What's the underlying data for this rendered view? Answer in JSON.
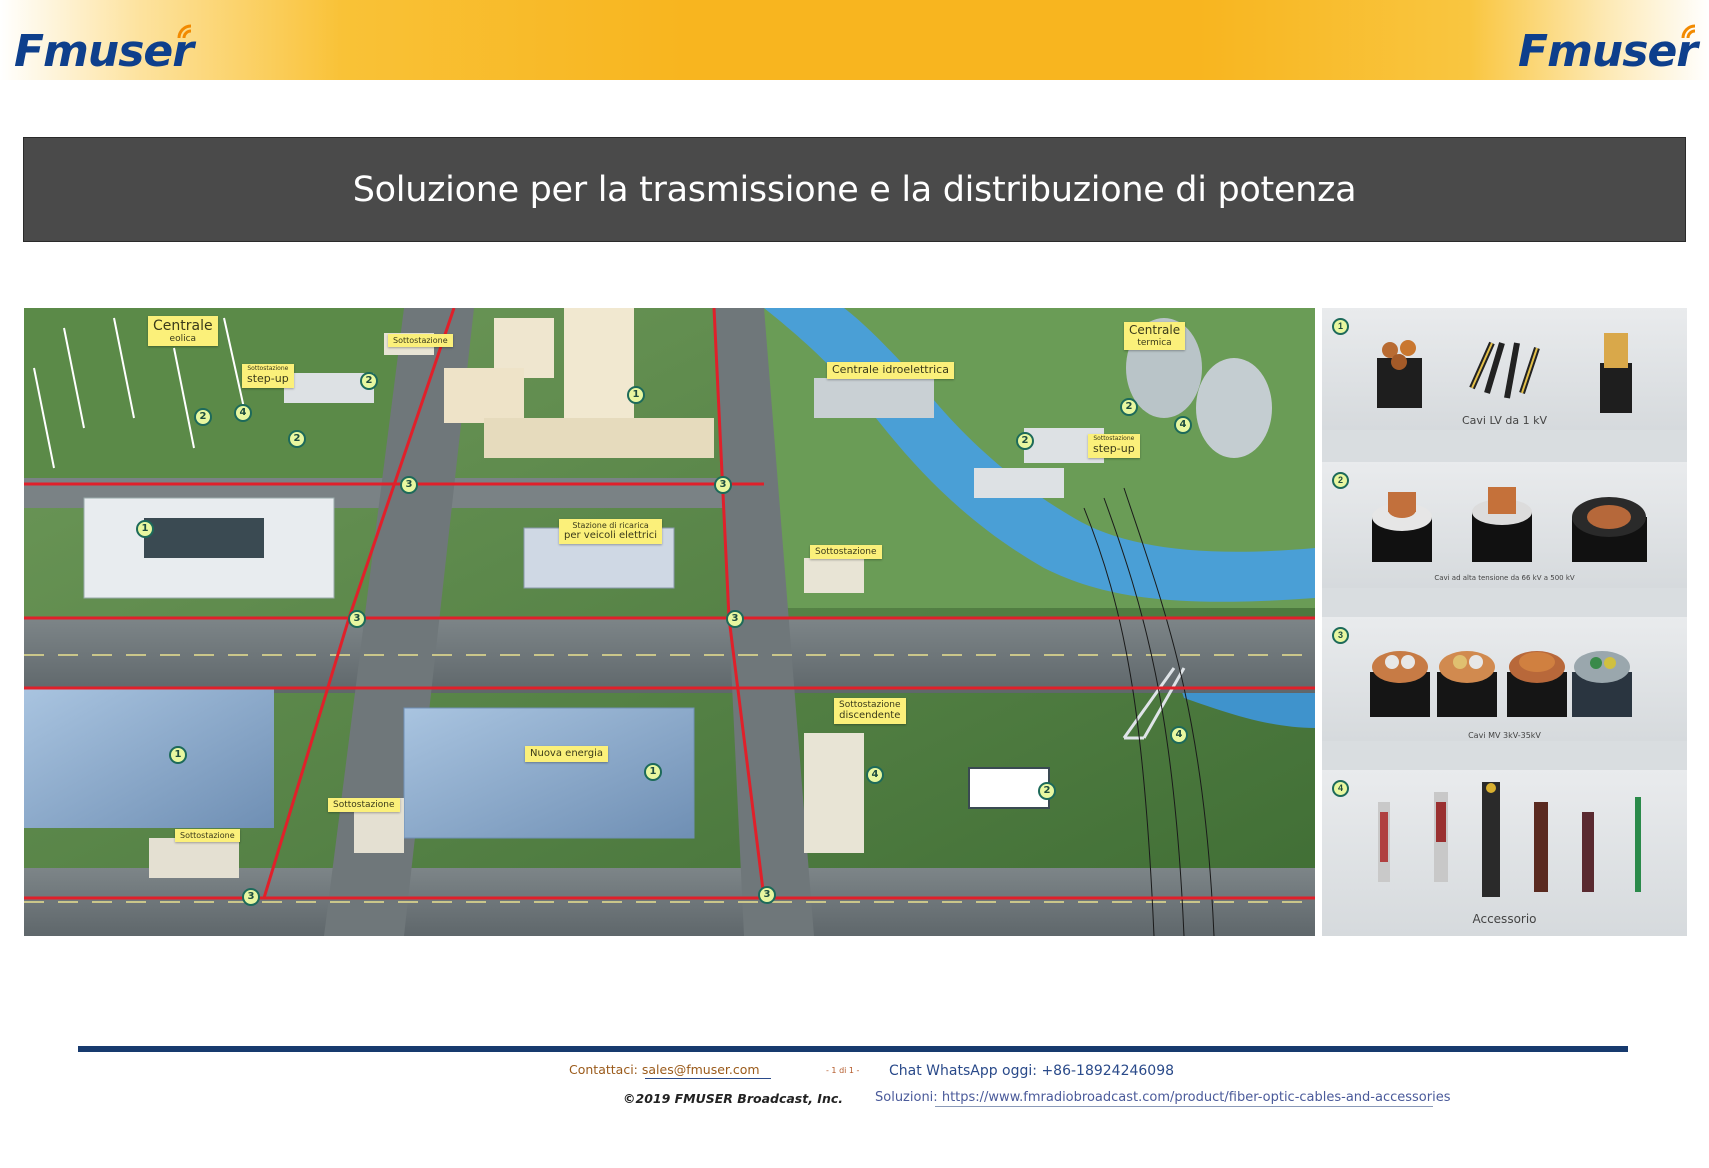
{
  "header": {
    "logo_left": "FMUSER",
    "logo_right": "FMUSER",
    "title": "Soluzione per la trasmissione e la distribuzione di potenza"
  },
  "map": {
    "labels": {
      "wind_1": "Centrale",
      "wind_2": "eolica",
      "substation_top": "Sottostazione",
      "stepup_left_1": "Sottostazione",
      "stepup_left_2": "step-up",
      "hydro": "Centrale idroelettrica",
      "thermal_1": "Centrale",
      "thermal_2": "termica",
      "stepup_right_1": "Sottostazione",
      "stepup_right_2": "step-up",
      "charging_1": "Stazione di ricarica",
      "charging_2": "per veicoli elettrici",
      "substation_mid": "Sottostazione",
      "stepdown_1": "Sottostazione",
      "stepdown_2": "discendente",
      "new_energy": "Nuova energia",
      "substation_bottom": "Sottostazione",
      "substation_bottom_left": "Sottostazione"
    },
    "markers": [
      "1",
      "2",
      "3",
      "4"
    ]
  },
  "products": [
    {
      "badge": "1",
      "caption": "Cavi LV da 1 kV"
    },
    {
      "badge": "2",
      "caption": "Cavi ad alta tensione da 66 kV a 500 kV"
    },
    {
      "badge": "3",
      "caption": "Cavi MV 3kV-35kV"
    },
    {
      "badge": "4",
      "caption": "Accessorio"
    }
  ],
  "footer": {
    "contact_label": "Contattaci:",
    "contact_email": "sales@fmuser.com",
    "page": "- 1 di 1 -",
    "whatsapp": "Chat WhatsApp oggi: +86-18924246098",
    "copyright": "©2019 FMUSER Broadcast, Inc.",
    "solutions_label": "Soluzioni:",
    "solutions_url": "https://www.fmradiobroadcast.com/product/fiber-optic-cables-and-accessories"
  },
  "colors": {
    "banner": "#f8b51f",
    "logo": "#0e3f8c",
    "title_bar": "#4a4a4a",
    "power_line": "#e0202a",
    "label_bg": "#fbf07a",
    "footer_line": "#173a6e"
  }
}
